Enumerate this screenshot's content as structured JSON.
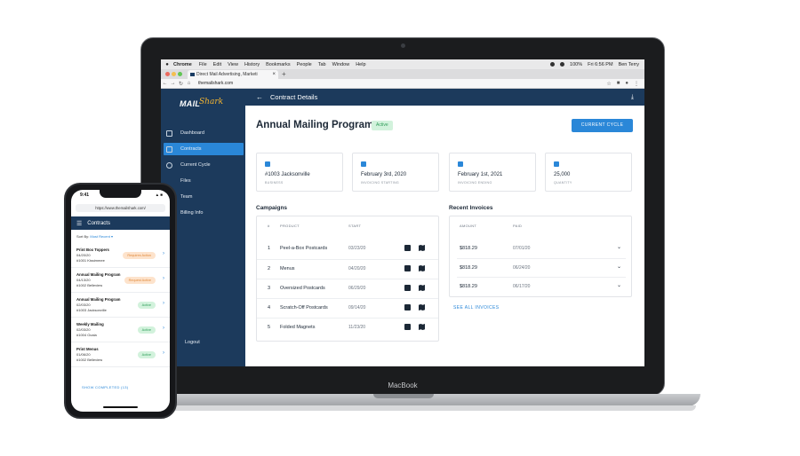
{
  "laptop": {
    "brand": "MacBook",
    "menubar": {
      "app": "Chrome",
      "items": [
        "File",
        "Edit",
        "View",
        "History",
        "Bookmarks",
        "People",
        "Tab",
        "Window",
        "Help"
      ],
      "battery": "100%",
      "time": "Fri 6:56 PM",
      "user": "Ben Terry"
    },
    "browser": {
      "tab_title": "Direct Mail Advertising, Marketi",
      "url": "themailshark.com"
    },
    "app": {
      "logo": "MAIL",
      "logo_script": "Shark",
      "topbar_title": "Contract Details",
      "nav": [
        {
          "label": "Dashboard"
        },
        {
          "label": "Contracts"
        },
        {
          "label": "Current Cycle"
        },
        {
          "label": "Files"
        },
        {
          "label": "Team"
        },
        {
          "label": "Billing Info"
        }
      ],
      "logout": "Logout",
      "page_title": "Annual Mailing Program",
      "status_badge": "Active",
      "cycle_button": "CURRENT CYCLE",
      "cards": [
        {
          "value": "#1003 Jacksonville",
          "label": "BUSINESS"
        },
        {
          "value": "February 3rd, 2020",
          "label": "INVOICING STARTING"
        },
        {
          "value": "February 1st, 2021",
          "label": "INVOICING ENDING"
        },
        {
          "value": "25,000",
          "label": "QUANTITY"
        }
      ],
      "campaigns": {
        "title": "Campaigns",
        "headers": {
          "num": "#",
          "product": "PRODUCT",
          "start": "START"
        },
        "rows": [
          {
            "num": "1",
            "product": "Peel-a-Box Postcards",
            "start": "03/23/20"
          },
          {
            "num": "2",
            "product": "Menus",
            "start": "04/20/20"
          },
          {
            "num": "3",
            "product": "Oversized Postcards",
            "start": "06/29/20"
          },
          {
            "num": "4",
            "product": "Scratch-Off Postcards",
            "start": "09/14/20"
          },
          {
            "num": "5",
            "product": "Folded Magnets",
            "start": "11/23/20"
          }
        ]
      },
      "invoices": {
        "title": "Recent Invoices",
        "headers": {
          "amount": "AMOUNT",
          "paid": "PAID"
        },
        "rows": [
          {
            "amount": "$818.29",
            "paid": "07/01/20"
          },
          {
            "amount": "$818.29",
            "paid": "06/24/20"
          },
          {
            "amount": "$818.29",
            "paid": "06/17/20"
          }
        ],
        "see_all": "SEE ALL INVOICES"
      }
    }
  },
  "phone": {
    "time": "9:41",
    "url": "https://www.themailshark.com/",
    "header": "Contracts",
    "sort_label": "Sort By:",
    "sort_value": "Most Recent",
    "items": [
      {
        "title": "Print Box Toppers",
        "date": "04/20/20",
        "location": "#1001 Kissimmee",
        "status": "Requires Action",
        "kind": "warn"
      },
      {
        "title": "Annual Mailing Program",
        "date": "04/13/20",
        "location": "#1002 Belleview",
        "status": "Request Active",
        "kind": "warn"
      },
      {
        "title": "Annual Mailing Program",
        "date": "02/03/20",
        "location": "#1003 Jacksonville",
        "status": "Active",
        "kind": "ok"
      },
      {
        "title": "Weekly Mailing",
        "date": "02/03/20",
        "location": "#1004 Ocala",
        "status": "Active",
        "kind": "ok"
      },
      {
        "title": "Print Menus",
        "date": "01/06/20",
        "location": "#1002 Belleview",
        "status": "Active",
        "kind": "ok"
      }
    ],
    "show_completed": "SHOW COMPLETED (13)"
  }
}
